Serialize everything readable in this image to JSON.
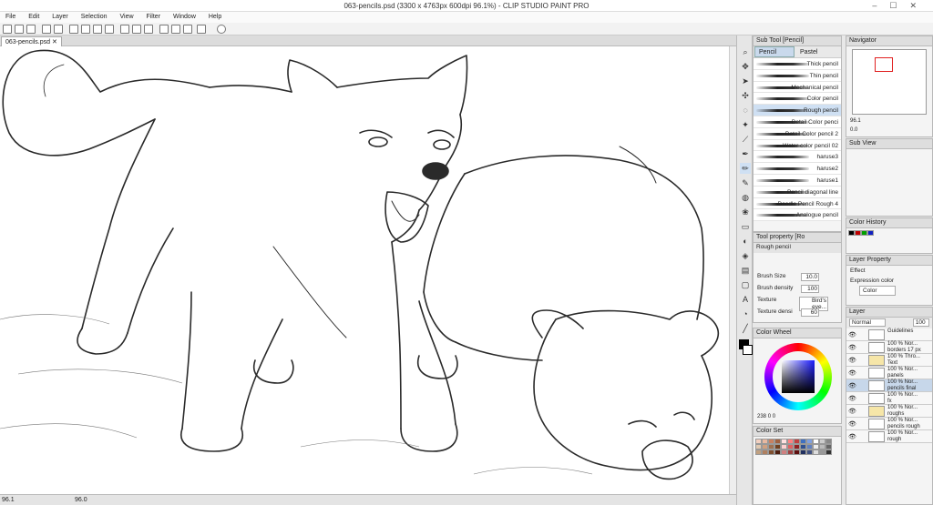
{
  "window": {
    "title": "063-pencils.psd (3300 x 4763px 600dpi 96.1%)  - CLIP STUDIO PAINT PRO"
  },
  "menu": [
    "File",
    "Edit",
    "Layer",
    "Selection",
    "View",
    "Filter",
    "Window",
    "Help"
  ],
  "document": {
    "tab_label": "063-pencils.psd"
  },
  "status": {
    "zoom": "96.1",
    "zoom2": "96.0"
  },
  "subtool": {
    "header": "Sub Tool [Pencil]",
    "tabs": [
      "Pencil",
      "Pastel"
    ],
    "brushes": [
      "Thick pencil",
      "Thin pencil",
      "Mechanical pencil",
      "Color pencil",
      "Rough pencil",
      "Detail Color penci",
      "Detail Color pencil 2",
      "Water color pencil 02",
      "haruse3",
      "haruse2",
      "haruse1",
      "Pencil diagonal line",
      "Doodle Pencil Rough 4",
      "Analogue pencil"
    ],
    "selected_index": 4
  },
  "tool_property": {
    "header": "Tool property [Ro",
    "tool_name": "Rough pencil",
    "rows": [
      {
        "label": "Brush Size",
        "value": "10.0"
      },
      {
        "label": "Brush density",
        "value": "100"
      },
      {
        "label": "Texture",
        "value": "Bird's eye..."
      },
      {
        "label": "Texture densi",
        "value": "60"
      }
    ]
  },
  "navigator": {
    "header": "Navigator",
    "zoom": "96.1",
    "angle": "0.0"
  },
  "subview": {
    "header": "Sub View"
  },
  "color_history": {
    "header": "Color History"
  },
  "layer_property": {
    "header": "Layer Property",
    "effect_label": "Effect",
    "expression_label": "Expression color",
    "expression_value": "Color"
  },
  "layer_panel": {
    "header": "Layer",
    "blend": "Normal",
    "opacity": "100",
    "layers": [
      {
        "t1": "Guidelines",
        "t2": ""
      },
      {
        "t1": "100 % Nor...",
        "t2": "borders 17 px"
      },
      {
        "t1": "100 % Thro...",
        "t2": "Text"
      },
      {
        "t1": "100 % Nor...",
        "t2": "panels"
      },
      {
        "t1": "100 % Nor...",
        "t2": "pencils final"
      },
      {
        "t1": "100 % Nor...",
        "t2": "fx"
      },
      {
        "t1": "100 % Nor...",
        "t2": "roughs"
      },
      {
        "t1": "100 % Nor...",
        "t2": "pencils rough"
      },
      {
        "t1": "100 % Nor...",
        "t2": "rough"
      }
    ],
    "selected_index": 4
  },
  "color_wheel": {
    "header": "Color Wheel",
    "value1": "238",
    "value2": "0",
    "value3": "0"
  },
  "color_set": {
    "header": "Color Set"
  },
  "colors": {
    "accent": "#2a6fd6",
    "selection": "#cfe0f3",
    "panel": "#f4f4f4"
  }
}
